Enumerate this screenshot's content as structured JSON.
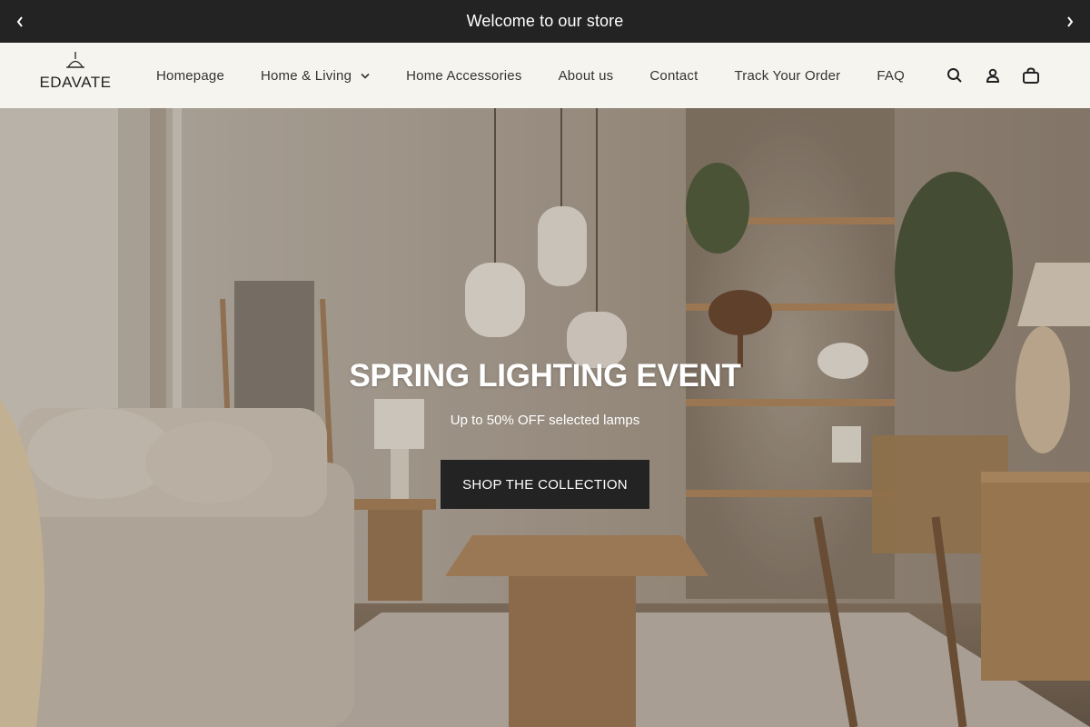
{
  "announcement": {
    "text": "Welcome to our store",
    "prev_icon": "chevron-left-icon",
    "next_icon": "chevron-right-icon"
  },
  "header": {
    "logo_text": "EDAVATE",
    "nav": [
      {
        "label": "Homepage"
      },
      {
        "label": "Home & Living",
        "has_dropdown": true
      },
      {
        "label": "Home Accessories"
      },
      {
        "label": "About us"
      },
      {
        "label": "Contact"
      },
      {
        "label": "Track Your Order"
      },
      {
        "label": "FAQ"
      }
    ],
    "icons": [
      "search-icon",
      "account-icon",
      "cart-icon"
    ]
  },
  "hero": {
    "title": "SPRING LIGHTING EVENT",
    "subtitle": "Up to 50% OFF selected lamps",
    "button_label": "SHOP THE COLLECTION"
  },
  "colors": {
    "bar_bg": "#232323",
    "header_bg": "#f6f4ef",
    "button_bg": "#232323",
    "text_light": "#ffffff"
  }
}
